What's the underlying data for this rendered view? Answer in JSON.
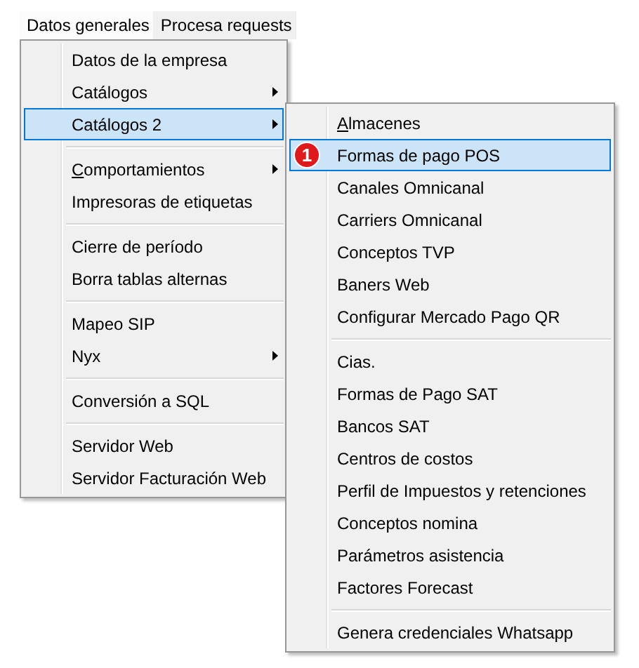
{
  "menu_bar": [
    {
      "label": "Datos generales",
      "selected": true
    },
    {
      "label": "Procesa requests",
      "selected": false
    }
  ],
  "menu": {
    "items": [
      {
        "kind": "item",
        "label": "Datos de la empresa",
        "submenu": false,
        "selected": false
      },
      {
        "kind": "item",
        "label": "Catálogos",
        "submenu": true,
        "selected": false
      },
      {
        "kind": "item",
        "label": "Catálogos 2",
        "submenu": true,
        "selected": true
      },
      {
        "kind": "separator"
      },
      {
        "kind": "item",
        "label": "Comportamientos",
        "submenu": true,
        "selected": false,
        "underline_first": true
      },
      {
        "kind": "item",
        "label": "Impresoras de etiquetas",
        "submenu": false,
        "selected": false
      },
      {
        "kind": "separator"
      },
      {
        "kind": "item",
        "label": "Cierre de período",
        "submenu": false,
        "selected": false
      },
      {
        "kind": "item",
        "label": "Borra tablas alternas",
        "submenu": false,
        "selected": false
      },
      {
        "kind": "separator"
      },
      {
        "kind": "item",
        "label": "Mapeo SIP",
        "submenu": false,
        "selected": false
      },
      {
        "kind": "item",
        "label": "Nyx",
        "submenu": true,
        "selected": false
      },
      {
        "kind": "separator"
      },
      {
        "kind": "item",
        "label": "Conversión a SQL",
        "submenu": false,
        "selected": false
      },
      {
        "kind": "separator"
      },
      {
        "kind": "item",
        "label": "Servidor Web",
        "submenu": false,
        "selected": false
      },
      {
        "kind": "item",
        "label": "Servidor Facturación Web",
        "submenu": false,
        "selected": false
      }
    ]
  },
  "submenu": {
    "items": [
      {
        "kind": "item",
        "label": "Almacenes",
        "submenu": false,
        "selected": false,
        "underline_first": true
      },
      {
        "kind": "item",
        "label": "Formas de pago POS",
        "submenu": false,
        "selected": true,
        "badge": "1"
      },
      {
        "kind": "item",
        "label": "Canales Omnicanal",
        "submenu": false,
        "selected": false
      },
      {
        "kind": "item",
        "label": "Carriers Omnicanal",
        "submenu": false,
        "selected": false
      },
      {
        "kind": "item",
        "label": "Conceptos TVP",
        "submenu": false,
        "selected": false
      },
      {
        "kind": "item",
        "label": "Baners Web",
        "submenu": false,
        "selected": false
      },
      {
        "kind": "item",
        "label": "Configurar Mercado Pago QR",
        "submenu": false,
        "selected": false
      },
      {
        "kind": "separator"
      },
      {
        "kind": "item",
        "label": "Cias.",
        "submenu": false,
        "selected": false
      },
      {
        "kind": "item",
        "label": "Formas de Pago SAT",
        "submenu": false,
        "selected": false
      },
      {
        "kind": "item",
        "label": "Bancos SAT",
        "submenu": false,
        "selected": false
      },
      {
        "kind": "item",
        "label": "Centros de costos",
        "submenu": false,
        "selected": false
      },
      {
        "kind": "item",
        "label": "Perfil de Impuestos y retenciones",
        "submenu": false,
        "selected": false
      },
      {
        "kind": "item",
        "label": "Conceptos nomina",
        "submenu": false,
        "selected": false
      },
      {
        "kind": "item",
        "label": "Parámetros asistencia",
        "submenu": false,
        "selected": false
      },
      {
        "kind": "item",
        "label": "Factores Forecast",
        "submenu": false,
        "selected": false
      },
      {
        "kind": "separator"
      },
      {
        "kind": "item",
        "label": "Genera credenciales Whatsapp",
        "submenu": false,
        "selected": false
      }
    ]
  }
}
